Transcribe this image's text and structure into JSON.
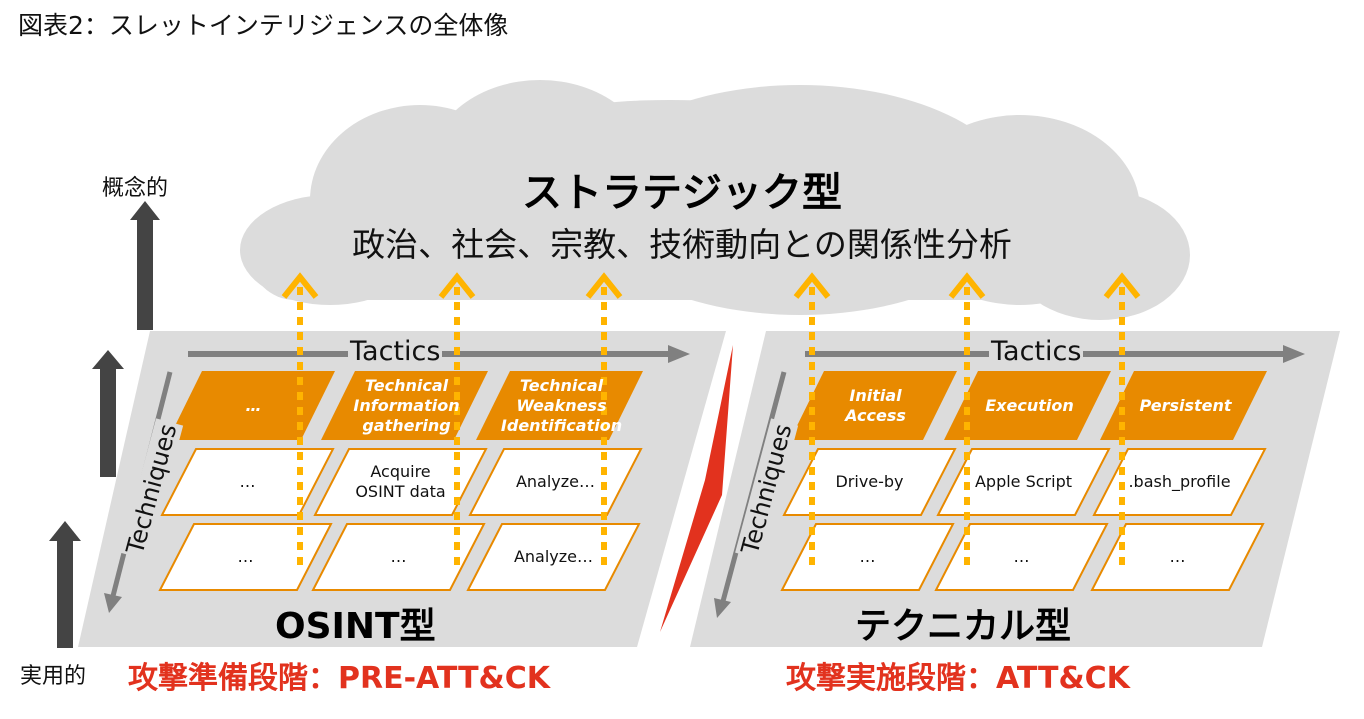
{
  "figure_title": "図表2：スレットインテリジェンスの全体像",
  "colors": {
    "panel_gray": "#dcdcdc",
    "orange": "#e88a00",
    "arrow_yellow": "#ffb400",
    "red": "#e2321e",
    "dark_arrow": "#444444",
    "axis_gray": "#808080"
  },
  "vertical_axis": {
    "top_label": "概念的",
    "bottom_label": "実用的"
  },
  "strategic": {
    "title": "ストラテジック型",
    "subtitle": "政治、社会、宗教、技術動向との関係性分析"
  },
  "panels": [
    {
      "id": "osint",
      "name": "OSINT型",
      "phase": "攻撃準備段階：PRE-ATT&CK",
      "tactics_axis": "Tactics",
      "techniques_axis": "Techniques",
      "tactics": [
        "…",
        "Technical Information gathering",
        "Technical Weakness Identification"
      ],
      "tactic_lines": [
        [
          "…"
        ],
        [
          "Technical",
          "Information",
          "gathering"
        ],
        [
          "Technical",
          "Weakness",
          "Identification"
        ]
      ],
      "techniques": [
        [
          [
            "…"
          ],
          [
            "Acquire",
            "OSINT data"
          ],
          [
            "Analyze…"
          ]
        ],
        [
          [
            "…"
          ],
          [
            "…"
          ],
          [
            "Analyze…"
          ]
        ]
      ]
    },
    {
      "id": "technical",
      "name": "テクニカル型",
      "phase": "攻撃実施段階：ATT&CK",
      "tactics_axis": "Tactics",
      "techniques_axis": "Techniques",
      "tactics": [
        "Initial Access",
        "Execution",
        "Persistent"
      ],
      "tactic_lines": [
        [
          "Initial",
          "Access"
        ],
        [
          "Execution"
        ],
        [
          "Persistent"
        ]
      ],
      "techniques": [
        [
          [
            "Drive-by"
          ],
          [
            "Apple Script"
          ],
          [
            ".bash_profile"
          ]
        ],
        [
          [
            "…"
          ],
          [
            "…"
          ],
          [
            "…"
          ]
        ]
      ]
    }
  ]
}
